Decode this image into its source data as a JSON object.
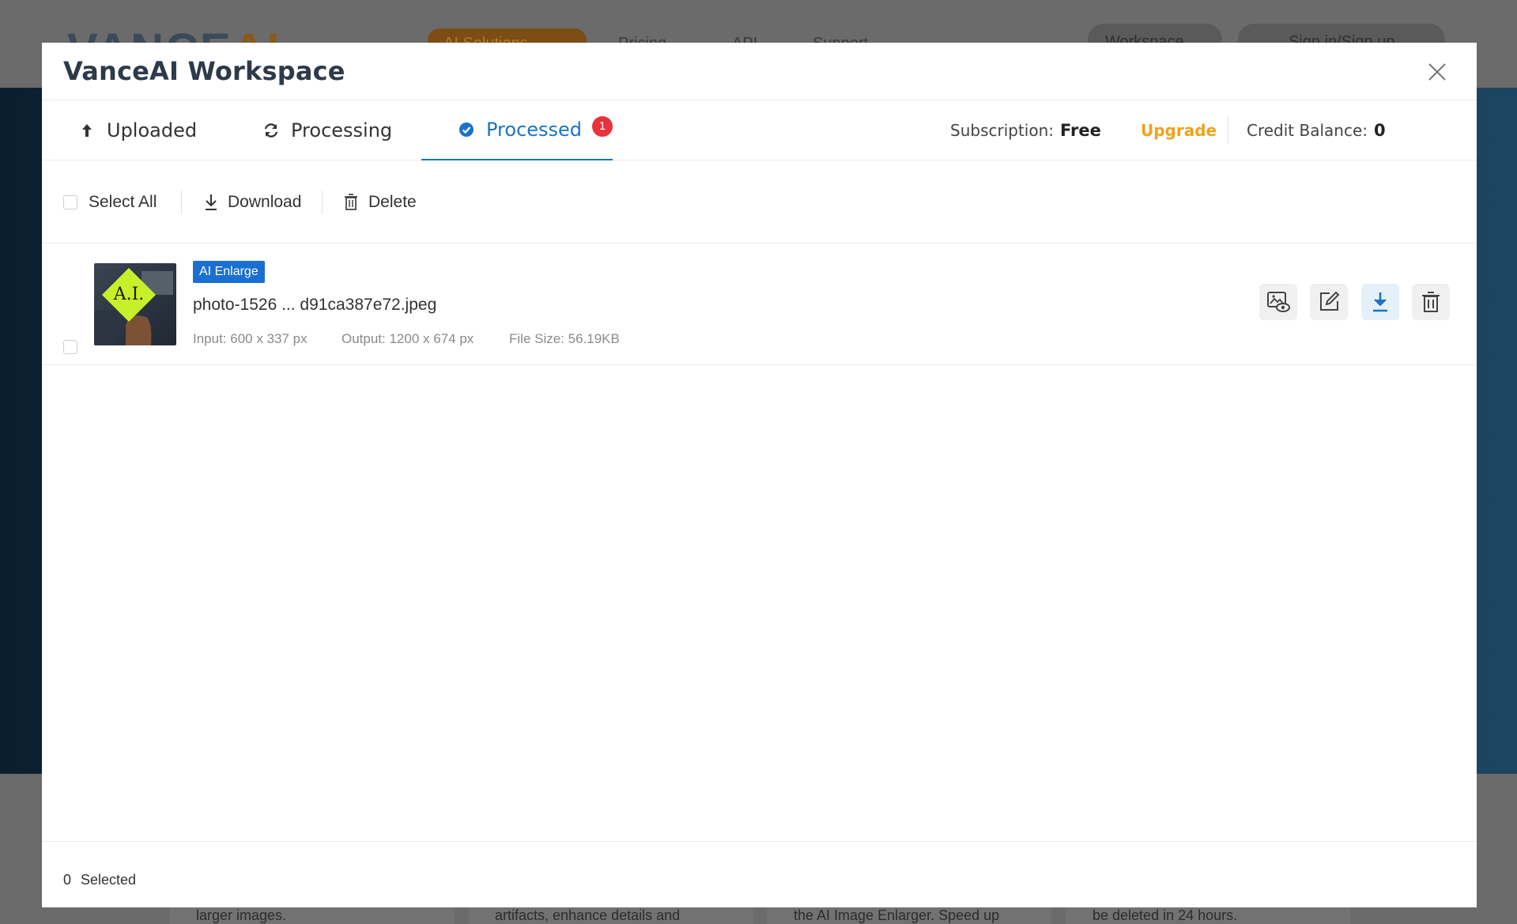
{
  "background": {
    "logo_main": "VANCE",
    "logo_ai": "AI",
    "nav_pill": "AI Solutions",
    "nav_items": [
      "Pricing",
      "API",
      "Support"
    ],
    "workspace_pill": "Workspace",
    "signin_pill": "Sign in/Sign up",
    "card_snippets": [
      "larger images.",
      "artifacts, enhance details and",
      "the AI Image Enlarger. Speed up",
      "be deleted in 24 hours."
    ]
  },
  "modal": {
    "title": "VanceAI Workspace",
    "tabs": [
      {
        "label": "Uploaded",
        "icon": "upload-arrow-icon"
      },
      {
        "label": "Processing",
        "icon": "refresh-icon"
      },
      {
        "label": "Processed",
        "icon": "check-circle-icon",
        "badge": "1",
        "active": true
      }
    ],
    "subscription": {
      "label": "Subscription:",
      "value": "Free"
    },
    "upgrade_label": "Upgrade",
    "credit": {
      "label": "Credit Balance:",
      "value": "0"
    },
    "toolbar": {
      "select_all_label": "Select All",
      "download_label": "Download",
      "delete_label": "Delete"
    },
    "files": [
      {
        "tag": "AI Enlarge",
        "name": "photo-1526 ... d91ca387e72.jpeg",
        "input": "Input: 600 x 337 px",
        "output": "Output: 1200 x 674 px",
        "size": "File Size: 56.19KB",
        "thumb_text": "A.I."
      }
    ],
    "footer": {
      "selected_count": "0",
      "selected_label": "Selected"
    }
  },
  "colors": {
    "accent_blue": "#1a73c8",
    "tag_blue": "#1a6fd1",
    "upgrade_orange": "#f0a21a",
    "badge_red": "#e8323c"
  }
}
